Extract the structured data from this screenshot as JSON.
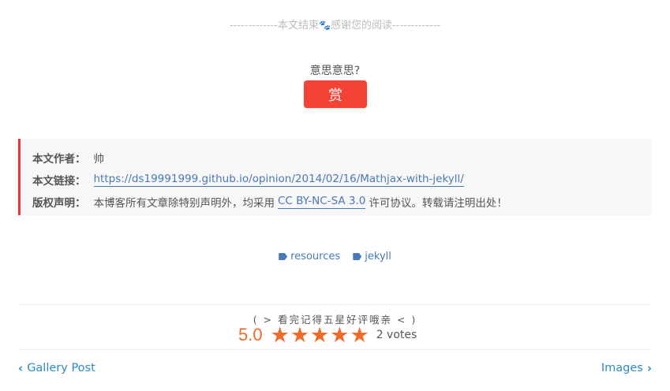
{
  "end_notice": {
    "left": "-------------本文结束",
    "paw_icon": "paw-icon",
    "right": "感谢您的阅读-------------"
  },
  "reward": {
    "prompt": "意思意思?",
    "button_label": "赏",
    "button_color": "#f44336"
  },
  "copyright": {
    "author_key": "本文作者：",
    "author_value": "帅",
    "link_key": "本文链接：",
    "link_value": "https://ds19991999.github.io/opinion/2014/02/16/Mathjax-with-jekyll/",
    "license_key": "版权声明：",
    "license_before": "本博客所有文章除特别声明外，均采用",
    "license_link": "CC BY-NC-SA 3.0",
    "license_after": "许可协议。转载请注明出处！",
    "accent_color": "#e53935"
  },
  "tags": [
    {
      "label": "resources",
      "icon": "tag-icon"
    },
    {
      "label": "jekyll",
      "icon": "tag-icon"
    }
  ],
  "rating": {
    "title": "( > 看完记得五星好评哦亲 < )",
    "score": "5.0",
    "stars": 5,
    "max_stars": 5,
    "votes": "2 votes",
    "accent_color": "#f06a2a"
  },
  "post_nav": {
    "prev_label": "Gallery Post",
    "next_label": "Images"
  }
}
